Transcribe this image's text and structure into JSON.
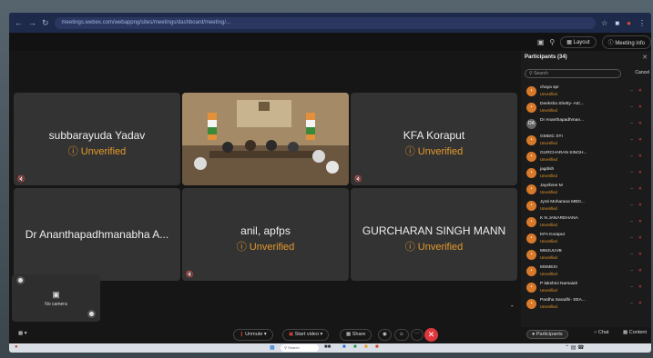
{
  "browser": {
    "url": "meetings.webex.com/webappng/sites/meetings/dashboard/meeting/..."
  },
  "topbar": {
    "layout_label": "Layout",
    "meeting_info_label": "Meeting info"
  },
  "tiles": [
    {
      "name": "subbarayuda Yadav",
      "status": "Unverified"
    },
    {
      "name": "KFA Koraput",
      "status": "Unverified"
    },
    {
      "name": "Dr Ananthapadhmanabha A...",
      "status": ""
    },
    {
      "name": "anil, apfps",
      "status": "Unverified"
    },
    {
      "name": "GURCHARAN SINGH MANN",
      "status": "Unverified"
    }
  ],
  "self_view": {
    "label": "No camera"
  },
  "controls": {
    "unmute": "Unmute",
    "start_video": "Start video",
    "share": "Share"
  },
  "participants": {
    "header": "Participants (34)",
    "search_placeholder": "Search",
    "cancel": "Cancel",
    "items": [
      {
        "name": "chaya spr",
        "status": "Unverified",
        "initials": ""
      },
      {
        "name": "Deeksha Shetty- AIC...",
        "status": "Unverified",
        "initials": ""
      },
      {
        "name": "Dr Ananthapadhman...",
        "status": "",
        "initials": "DA"
      },
      {
        "name": "GMDIC STI",
        "status": "Unverified",
        "initials": ""
      },
      {
        "name": "GURCHARAN SINGH...",
        "status": "Unverified",
        "initials": ""
      },
      {
        "name": "jagdish",
        "status": "Unverified",
        "initials": ""
      },
      {
        "name": "Jayshree M",
        "status": "Unverified",
        "initials": ""
      },
      {
        "name": "Jyoti Moharana MBD...",
        "status": "Unverified",
        "initials": ""
      },
      {
        "name": "K N JANARDHANA",
        "status": "Unverified",
        "initials": ""
      },
      {
        "name": "KFA Koraput",
        "status": "Unverified",
        "initials": ""
      },
      {
        "name": "MMJUUVB",
        "status": "Unverified",
        "initials": ""
      },
      {
        "name": "MSMESI",
        "status": "Unverified",
        "initials": ""
      },
      {
        "name": "P lakshmi Narsaiah",
        "status": "Unverified",
        "initials": ""
      },
      {
        "name": "Pardha Saradhi- SEA...",
        "status": "Unverified",
        "initials": ""
      }
    ]
  },
  "panel_tabs": {
    "participants": "Participants",
    "chat": "Chat",
    "content": "Content"
  },
  "taskbar": {
    "search": "Search"
  },
  "colors": {
    "unverified": "#e69a2c",
    "muted": "#e0483e",
    "end": "#e0373d"
  }
}
